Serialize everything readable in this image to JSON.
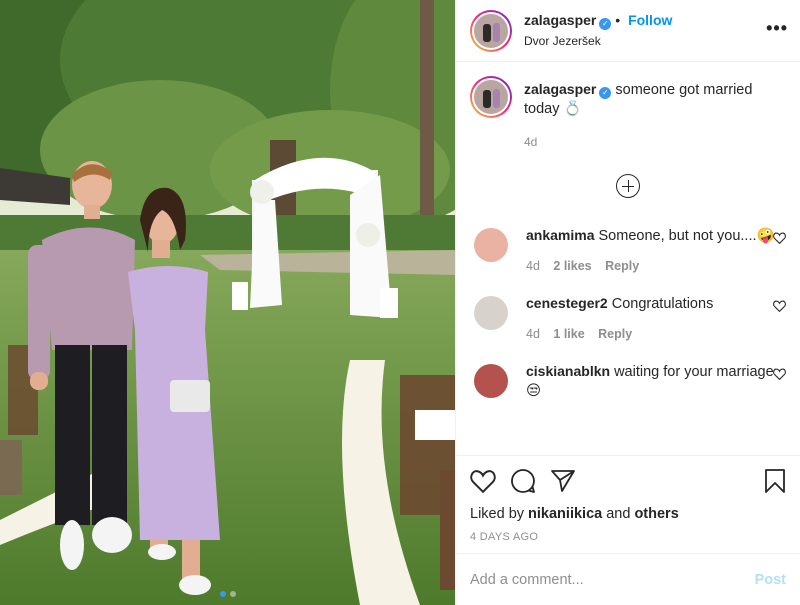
{
  "post": {
    "username": "zalagasper",
    "location": "Dvor Jezeršek",
    "follow_label": "Follow",
    "dot_sep": "•",
    "more": "•••",
    "caption": "someone got married today 💍",
    "caption_age": "4d",
    "image_alt": "Couple standing on lawn in front of white wedding arch",
    "carousel_dots": 2
  },
  "comments": [
    {
      "username": "ankamima",
      "text": "Someone, but not you....🤪",
      "age": "4d",
      "likes": "2 likes",
      "reply": "Reply",
      "avatar_color": "#e9b2a3"
    },
    {
      "username": "cenesteger2",
      "text": "Congratulations",
      "age": "4d",
      "likes": "1 like",
      "reply": "Reply",
      "avatar_color": "#d8d2cc"
    },
    {
      "username": "ciskianablkn",
      "text": "waiting for your marriage😒",
      "avatar_color": "#b4524d"
    }
  ],
  "actions": {
    "liked_by_prefix": "Liked by ",
    "liked_by_user": "nikaniikica",
    "liked_by_mid": " and ",
    "liked_by_suffix": "others",
    "timestamp": "4 DAYS AGO"
  },
  "add_comment": {
    "placeholder": "Add a comment...",
    "post_label": "Post"
  },
  "colors": {
    "accent": "#0095f6",
    "verified": "#3897f0",
    "muted": "#8e8e8e"
  }
}
